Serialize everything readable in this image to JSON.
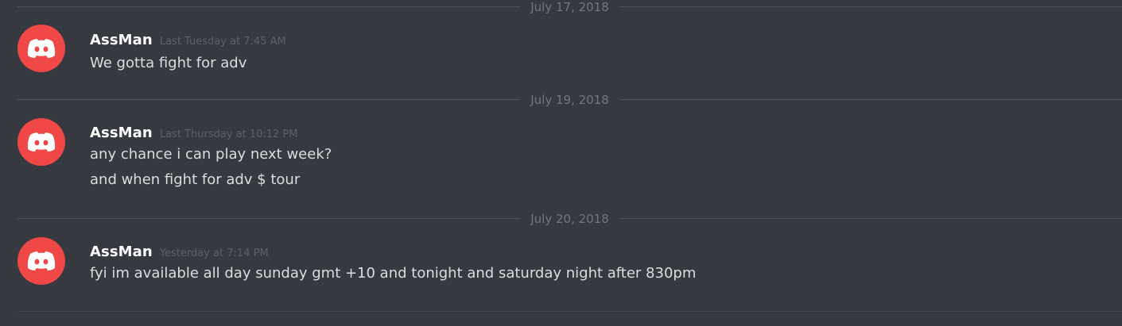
{
  "colors": {
    "background": "#36393f",
    "avatar": "#f04747",
    "username": "#ffffff",
    "message_text": "#dcddde",
    "timestamp": "#5d6167",
    "divider_line": "#4f545c",
    "divider_text": "#72767d"
  },
  "dividers": [
    {
      "date": "July 17, 2018"
    },
    {
      "date": "July 19, 2018"
    },
    {
      "date": "July 20, 2018"
    }
  ],
  "messages": [
    {
      "avatar_icon": "discord-logo-icon",
      "username": "AssMan",
      "timestamp": "Last Tuesday at 7:45 AM",
      "lines": [
        "We gotta fight for adv"
      ]
    },
    {
      "avatar_icon": "discord-logo-icon",
      "username": "AssMan",
      "timestamp": "Last Thursday at 10:12 PM",
      "lines": [
        "any chance i can play next week?",
        "and when fight for adv $ tour"
      ]
    },
    {
      "avatar_icon": "discord-logo-icon",
      "username": "AssMan",
      "timestamp": "Yesterday at 7:14 PM",
      "lines": [
        "fyi im available all day sunday gmt +10 and tonight and saturday night after 830pm"
      ]
    }
  ]
}
